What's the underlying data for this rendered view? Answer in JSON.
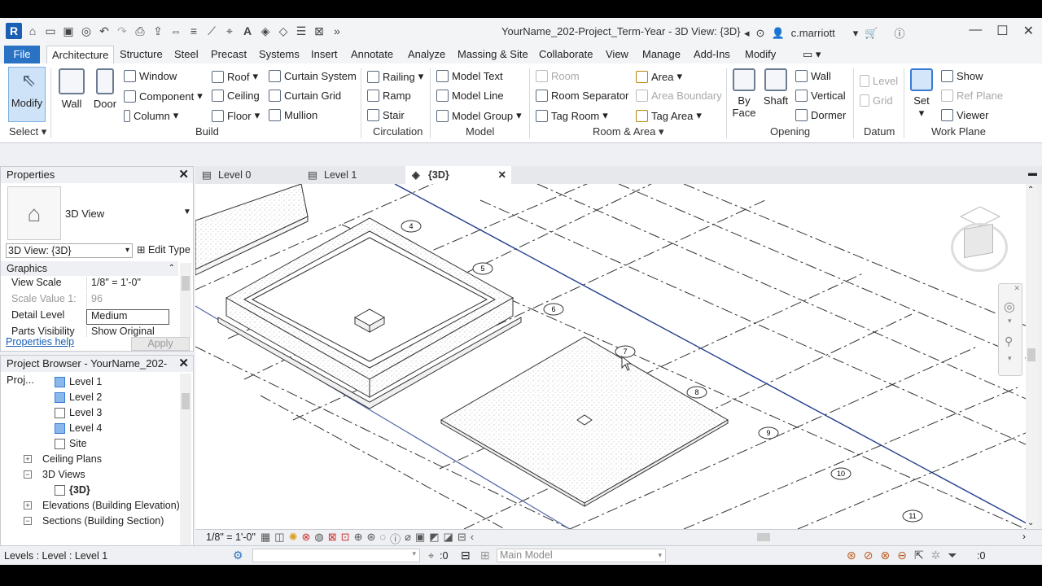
{
  "window": {
    "title": "YourName_202-Project_Term-Year - 3D View: {3D}",
    "user": "c.marriott",
    "app_logo": "R"
  },
  "ribbon": {
    "tabs": [
      "File",
      "Architecture",
      "Structure",
      "Steel",
      "Precast",
      "Systems",
      "Insert",
      "Annotate",
      "Analyze",
      "Massing & Site",
      "Collaborate",
      "View",
      "Manage",
      "Add-Ins",
      "Modify"
    ],
    "active_tab": "Architecture",
    "select": {
      "modify": "Modify",
      "label": "Select"
    },
    "build": {
      "wall": "Wall",
      "door": "Door",
      "window": "Window",
      "component": "Component",
      "column": "Column",
      "roof": "Roof",
      "ceiling": "Ceiling",
      "floor": "Floor",
      "curtain_system": "Curtain  System",
      "curtain_grid": "Curtain  Grid",
      "mullion": "Mullion",
      "label": "Build"
    },
    "circulation": {
      "railing": "Railing",
      "ramp": "Ramp",
      "stair": "Stair",
      "label": "Circulation"
    },
    "model": {
      "model_text": "Model  Text",
      "model_line": "Model  Line",
      "model_group": "Model  Group",
      "label": "Model"
    },
    "room_area": {
      "room": "Room",
      "room_separator": "Room  Separator",
      "tag_room": "Tag  Room",
      "area": "Area",
      "area_boundary": "Area  Boundary",
      "tag_area": "Tag  Area",
      "label": "Room & Area"
    },
    "opening": {
      "by_face_1": "By",
      "by_face_2": "Face",
      "shaft": "Shaft",
      "wall": "Wall",
      "vertical": "Vertical",
      "dormer": "Dormer",
      "label": "Opening"
    },
    "datum": {
      "level": "Level",
      "grid": "Grid",
      "label": "Datum"
    },
    "work_plane": {
      "set": "Set",
      "show": "Show",
      "ref_plane": "Ref  Plane",
      "viewer": "Viewer",
      "label": "Work Plane"
    }
  },
  "properties": {
    "title": "Properties",
    "type_name": "3D View",
    "selector": "3D View: {3D}",
    "edit_type": "Edit Type",
    "group": "Graphics",
    "rows": [
      {
        "k": "View Scale",
        "v": "1/8\" = 1'-0\""
      },
      {
        "k": "Scale Value    1:",
        "v": "96"
      },
      {
        "k": "Detail Level",
        "v": "Medium"
      },
      {
        "k": "Parts Visibility",
        "v": "Show Original"
      }
    ],
    "help": "Properties help",
    "apply": "Apply"
  },
  "browser": {
    "title": "Project Browser - YourName_202-Proj...",
    "items": [
      "Level 1",
      "Level 2",
      "Level 3",
      "Level 4",
      "Site",
      "Ceiling Plans",
      "3D Views",
      "{3D}",
      "Elevations (Building Elevation)",
      "Sections (Building Section)"
    ]
  },
  "view_tabs": [
    "Level 0",
    "Level 1",
    "{3D}"
  ],
  "grid_bubbles": [
    "4",
    "5",
    "6",
    "7",
    "8",
    "9",
    "10",
    "11"
  ],
  "view_bar": {
    "scale": "1/8\" = 1'-0\""
  },
  "status": {
    "text": "Levels : Level : Level 1",
    "sel_count": ":0",
    "workset": "Main Model",
    "filter_count": ":0"
  }
}
